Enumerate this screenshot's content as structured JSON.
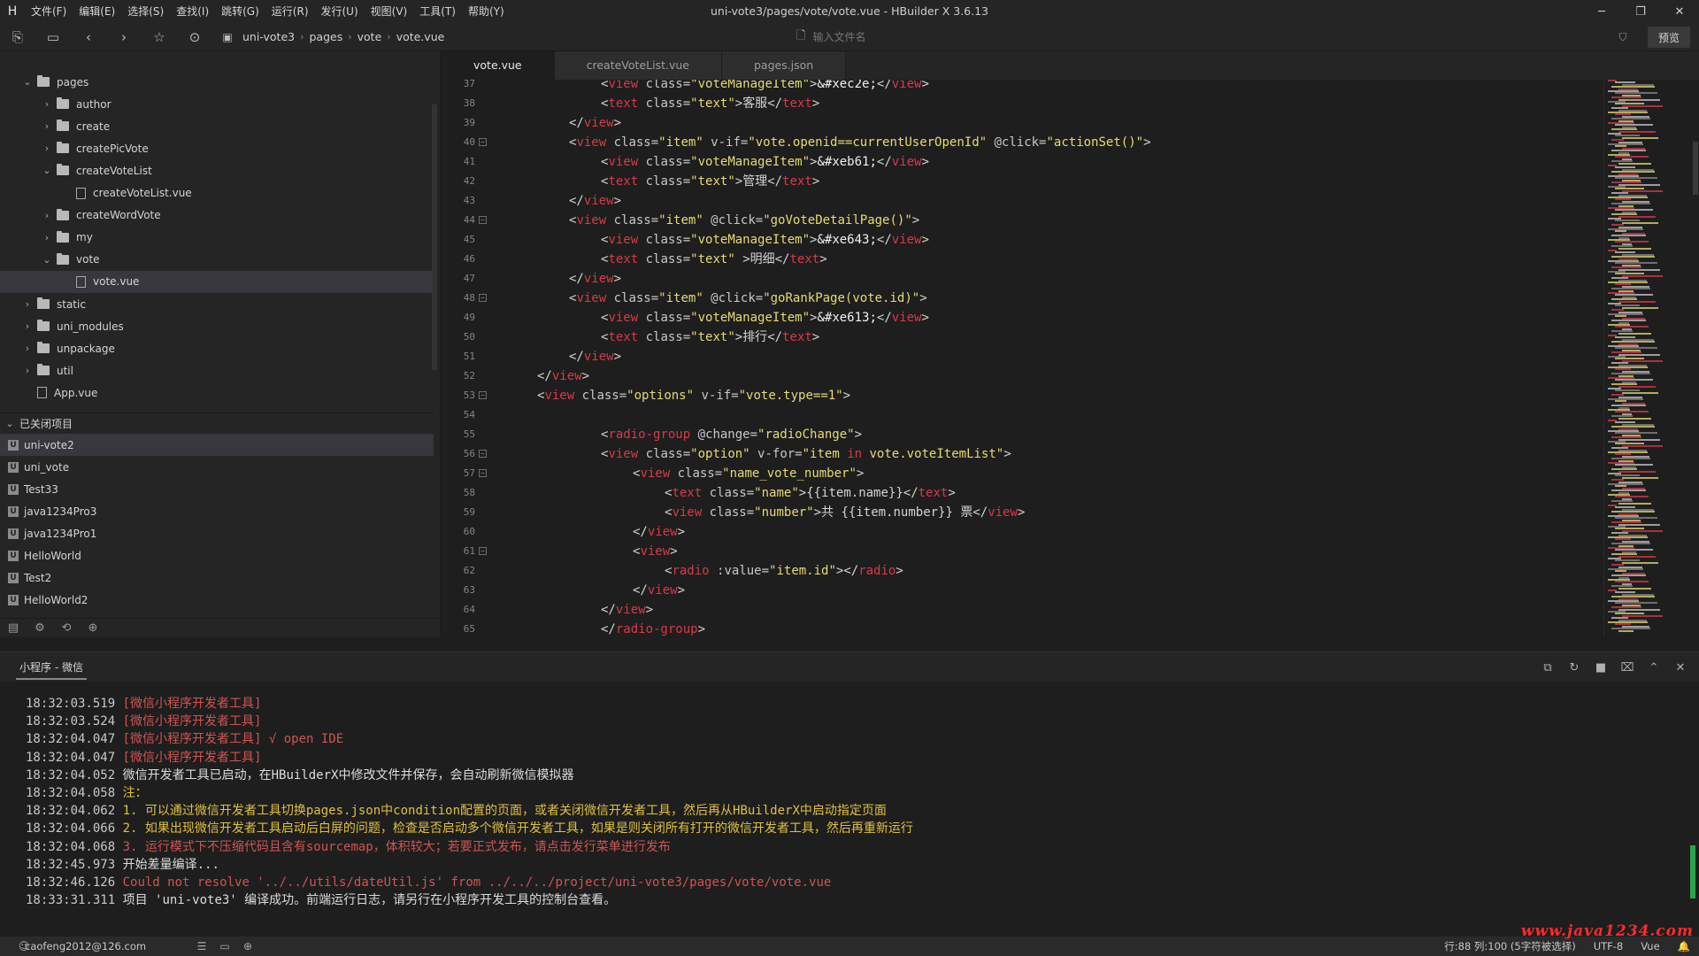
{
  "app": {
    "window_title": "uni-vote3/pages/vote/vote.vue - HBuilder X 3.6.13",
    "menu": [
      "文件(F)",
      "编辑(E)",
      "选择(S)",
      "查找(I)",
      "跳转(G)",
      "运行(R)",
      "发行(U)",
      "视图(V)",
      "工具(T)",
      "帮助(Y)"
    ]
  },
  "toolbar": {
    "breadcrumb": [
      "uni-vote3",
      "pages",
      "vote",
      "vote.vue"
    ],
    "file_search_placeholder": "输入文件名",
    "preview_label": "预览"
  },
  "sidebar": {
    "tree": [
      {
        "label": "pages",
        "type": "folder",
        "depth": 1,
        "expanded": true
      },
      {
        "label": "author",
        "type": "folder",
        "depth": 2,
        "expanded": false
      },
      {
        "label": "create",
        "type": "folder",
        "depth": 2,
        "expanded": false
      },
      {
        "label": "createPicVote",
        "type": "folder",
        "depth": 2,
        "expanded": false
      },
      {
        "label": "createVoteList",
        "type": "folder",
        "depth": 2,
        "expanded": true
      },
      {
        "label": "createVoteList.vue",
        "type": "file",
        "depth": 3
      },
      {
        "label": "createWordVote",
        "type": "folder",
        "depth": 2,
        "expanded": false
      },
      {
        "label": "my",
        "type": "folder",
        "depth": 2,
        "expanded": false
      },
      {
        "label": "vote",
        "type": "folder",
        "depth": 2,
        "expanded": true
      },
      {
        "label": "vote.vue",
        "type": "file",
        "depth": 3,
        "selected": true
      },
      {
        "label": "static",
        "type": "folder",
        "depth": 1,
        "expanded": false
      },
      {
        "label": "uni_modules",
        "type": "folder",
        "depth": 1,
        "expanded": false
      },
      {
        "label": "unpackage",
        "type": "folder",
        "depth": 1,
        "expanded": false
      },
      {
        "label": "util",
        "type": "folder",
        "depth": 1,
        "expanded": false
      },
      {
        "label": "App.vue",
        "type": "file",
        "depth": 1
      }
    ],
    "closed_projects_label": "已关闭项目",
    "closed_projects": [
      "uni-vote2",
      "uni_vote",
      "Test33",
      "java1234Pro3",
      "java1234Pro1",
      "HelloWorld",
      "Test2",
      "HelloWorld2"
    ]
  },
  "editor": {
    "tabs": [
      {
        "label": "vote.vue",
        "active": true
      },
      {
        "label": "createVoteList.vue",
        "active": false
      },
      {
        "label": "pages.json",
        "active": false
      }
    ],
    "lines": [
      {
        "n": "37",
        "fold": false,
        "indent": 3,
        "tokens": [
          [
            "t",
            "<"
          ],
          [
            "g",
            "view"
          ],
          [
            "a",
            " class="
          ],
          [
            "s",
            "\"voteManageItem\""
          ],
          [
            "t",
            ">"
          ],
          [
            "e",
            "&#xec2e;"
          ],
          [
            "t",
            "</"
          ],
          [
            "g",
            "view"
          ],
          [
            "t",
            ">"
          ]
        ]
      },
      {
        "n": "38",
        "fold": false,
        "indent": 3,
        "tokens": [
          [
            "t",
            "<"
          ],
          [
            "g",
            "text"
          ],
          [
            "a",
            " class="
          ],
          [
            "s",
            "\"text\""
          ],
          [
            "t",
            ">"
          ],
          [
            "x",
            "客服"
          ],
          [
            "t",
            "</"
          ],
          [
            "g",
            "text"
          ],
          [
            "t",
            ">"
          ]
        ]
      },
      {
        "n": "39",
        "fold": false,
        "indent": 2,
        "tokens": [
          [
            "t",
            "</"
          ],
          [
            "g",
            "view"
          ],
          [
            "t",
            ">"
          ]
        ]
      },
      {
        "n": "40",
        "fold": true,
        "indent": 2,
        "tokens": [
          [
            "t",
            "<"
          ],
          [
            "g",
            "view"
          ],
          [
            "a",
            " class="
          ],
          [
            "s",
            "\"item\""
          ],
          [
            "a",
            " v-if="
          ],
          [
            "s",
            "\"vote.openid==currentUserOpenId\""
          ],
          [
            "a",
            " @click="
          ],
          [
            "s",
            "\"actionSet()\""
          ],
          [
            "t",
            ">"
          ]
        ]
      },
      {
        "n": "41",
        "fold": false,
        "indent": 3,
        "tokens": [
          [
            "t",
            "<"
          ],
          [
            "g",
            "view"
          ],
          [
            "a",
            " class="
          ],
          [
            "s",
            "\"voteManageItem\""
          ],
          [
            "t",
            ">"
          ],
          [
            "e",
            "&#xeb61;"
          ],
          [
            "t",
            "</"
          ],
          [
            "g",
            "view"
          ],
          [
            "t",
            ">"
          ]
        ]
      },
      {
        "n": "42",
        "fold": false,
        "indent": 3,
        "tokens": [
          [
            "t",
            "<"
          ],
          [
            "g",
            "text"
          ],
          [
            "a",
            " class="
          ],
          [
            "s",
            "\"text\""
          ],
          [
            "t",
            ">"
          ],
          [
            "x",
            "管理"
          ],
          [
            "t",
            "</"
          ],
          [
            "g",
            "text"
          ],
          [
            "t",
            ">"
          ]
        ]
      },
      {
        "n": "43",
        "fold": false,
        "indent": 2,
        "tokens": [
          [
            "t",
            "</"
          ],
          [
            "g",
            "view"
          ],
          [
            "t",
            ">"
          ]
        ]
      },
      {
        "n": "44",
        "fold": true,
        "indent": 2,
        "tokens": [
          [
            "t",
            "<"
          ],
          [
            "g",
            "view"
          ],
          [
            "a",
            " class="
          ],
          [
            "s",
            "\"item\""
          ],
          [
            "a",
            " @click="
          ],
          [
            "s",
            "\"goVoteDetailPage()\""
          ],
          [
            "t",
            ">"
          ]
        ]
      },
      {
        "n": "45",
        "fold": false,
        "indent": 3,
        "tokens": [
          [
            "t",
            "<"
          ],
          [
            "g",
            "view"
          ],
          [
            "a",
            " class="
          ],
          [
            "s",
            "\"voteManageItem\""
          ],
          [
            "t",
            ">"
          ],
          [
            "e",
            "&#xe643;"
          ],
          [
            "t",
            "</"
          ],
          [
            "g",
            "view"
          ],
          [
            "t",
            ">"
          ]
        ]
      },
      {
        "n": "46",
        "fold": false,
        "indent": 3,
        "tokens": [
          [
            "t",
            "<"
          ],
          [
            "g",
            "text"
          ],
          [
            "a",
            " class="
          ],
          [
            "s",
            "\"text\" "
          ],
          [
            "t",
            ">"
          ],
          [
            "x",
            "明细"
          ],
          [
            "t",
            "</"
          ],
          [
            "g",
            "text"
          ],
          [
            "t",
            ">"
          ]
        ]
      },
      {
        "n": "47",
        "fold": false,
        "indent": 2,
        "tokens": [
          [
            "t",
            "</"
          ],
          [
            "g",
            "view"
          ],
          [
            "t",
            ">"
          ]
        ]
      },
      {
        "n": "48",
        "fold": true,
        "indent": 2,
        "tokens": [
          [
            "t",
            "<"
          ],
          [
            "g",
            "view"
          ],
          [
            "a",
            " class="
          ],
          [
            "s",
            "\"item\""
          ],
          [
            "a",
            " @click="
          ],
          [
            "s",
            "\"goRankPage(vote.id)\""
          ],
          [
            "t",
            ">"
          ]
        ]
      },
      {
        "n": "49",
        "fold": false,
        "indent": 3,
        "tokens": [
          [
            "t",
            "<"
          ],
          [
            "g",
            "view"
          ],
          [
            "a",
            " class="
          ],
          [
            "s",
            "\"voteManageItem\""
          ],
          [
            "t",
            ">"
          ],
          [
            "e",
            "&#xe613;"
          ],
          [
            "t",
            "</"
          ],
          [
            "g",
            "view"
          ],
          [
            "t",
            ">"
          ]
        ]
      },
      {
        "n": "50",
        "fold": false,
        "indent": 3,
        "tokens": [
          [
            "t",
            "<"
          ],
          [
            "g",
            "text"
          ],
          [
            "a",
            " class="
          ],
          [
            "s",
            "\"text\""
          ],
          [
            "t",
            ">"
          ],
          [
            "x",
            "排行"
          ],
          [
            "t",
            "</"
          ],
          [
            "g",
            "text"
          ],
          [
            "t",
            ">"
          ]
        ]
      },
      {
        "n": "51",
        "fold": false,
        "indent": 2,
        "tokens": [
          [
            "t",
            "</"
          ],
          [
            "g",
            "view"
          ],
          [
            "t",
            ">"
          ]
        ]
      },
      {
        "n": "52",
        "fold": false,
        "indent": 1,
        "tokens": [
          [
            "t",
            "</"
          ],
          [
            "g",
            "view"
          ],
          [
            "t",
            ">"
          ]
        ]
      },
      {
        "n": "53",
        "fold": true,
        "indent": 1,
        "tokens": [
          [
            "t",
            "<"
          ],
          [
            "g",
            "view"
          ],
          [
            "a",
            " class="
          ],
          [
            "s",
            "\"options\""
          ],
          [
            "a",
            " v-if="
          ],
          [
            "s",
            "\"vote.type==1\""
          ],
          [
            "t",
            ">"
          ]
        ]
      },
      {
        "n": "54",
        "fold": false,
        "indent": 0,
        "tokens": []
      },
      {
        "n": "55",
        "fold": false,
        "indent": 3,
        "tokens": [
          [
            "t",
            "<"
          ],
          [
            "g",
            "radio-group"
          ],
          [
            "a",
            " @change="
          ],
          [
            "s",
            "\"radioChange\""
          ],
          [
            "t",
            ">"
          ]
        ]
      },
      {
        "n": "56",
        "fold": true,
        "indent": 3,
        "tokens": [
          [
            "t",
            "<"
          ],
          [
            "g",
            "view"
          ],
          [
            "a",
            " class="
          ],
          [
            "s",
            "\"option\""
          ],
          [
            "a",
            " v-for="
          ],
          [
            "s",
            "\"item "
          ],
          [
            "k",
            "in"
          ],
          [
            "s",
            " vote.voteItemList\""
          ],
          [
            "t",
            ">"
          ]
        ]
      },
      {
        "n": "57",
        "fold": true,
        "indent": 4,
        "tokens": [
          [
            "t",
            "<"
          ],
          [
            "g",
            "view"
          ],
          [
            "a",
            " class="
          ],
          [
            "s",
            "\"name_vote_number\""
          ],
          [
            "t",
            ">"
          ]
        ]
      },
      {
        "n": "58",
        "fold": false,
        "indent": 5,
        "tokens": [
          [
            "t",
            "<"
          ],
          [
            "g",
            "text"
          ],
          [
            "a",
            " class="
          ],
          [
            "s",
            "\"name\""
          ],
          [
            "t",
            ">"
          ],
          [
            "x",
            "{{item.name}}"
          ],
          [
            "t",
            "</"
          ],
          [
            "g",
            "text"
          ],
          [
            "t",
            ">"
          ]
        ]
      },
      {
        "n": "59",
        "fold": false,
        "indent": 5,
        "tokens": [
          [
            "t",
            "<"
          ],
          [
            "g",
            "view"
          ],
          [
            "a",
            " class="
          ],
          [
            "s",
            "\"number\""
          ],
          [
            "t",
            ">"
          ],
          [
            "x",
            "共 {{item.number}} 票"
          ],
          [
            "t",
            "</"
          ],
          [
            "g",
            "view"
          ],
          [
            "t",
            ">"
          ]
        ]
      },
      {
        "n": "60",
        "fold": false,
        "indent": 4,
        "tokens": [
          [
            "t",
            "</"
          ],
          [
            "g",
            "view"
          ],
          [
            "t",
            ">"
          ]
        ]
      },
      {
        "n": "61",
        "fold": true,
        "indent": 4,
        "tokens": [
          [
            "t",
            "<"
          ],
          [
            "g",
            "view"
          ],
          [
            "t",
            ">"
          ]
        ]
      },
      {
        "n": "62",
        "fold": false,
        "indent": 5,
        "tokens": [
          [
            "t",
            "<"
          ],
          [
            "g",
            "radio"
          ],
          [
            "a",
            " :value="
          ],
          [
            "s",
            "\"item.id\""
          ],
          [
            "t",
            "></"
          ],
          [
            "g",
            "radio"
          ],
          [
            "t",
            ">"
          ]
        ]
      },
      {
        "n": "63",
        "fold": false,
        "indent": 4,
        "tokens": [
          [
            "t",
            "</"
          ],
          [
            "g",
            "view"
          ],
          [
            "t",
            ">"
          ]
        ]
      },
      {
        "n": "64",
        "fold": false,
        "indent": 3,
        "tokens": [
          [
            "t",
            "</"
          ],
          [
            "g",
            "view"
          ],
          [
            "t",
            ">"
          ]
        ]
      },
      {
        "n": "65",
        "fold": false,
        "indent": 3,
        "tokens": [
          [
            "t",
            "</"
          ],
          [
            "g",
            "radio-group"
          ],
          [
            "t",
            ">"
          ]
        ]
      }
    ]
  },
  "console": {
    "title": "小程序 - 微信",
    "lines": [
      {
        "time": "18:32:03.519",
        "parts": [
          [
            "tag",
            "[微信小程序开发者工具]"
          ]
        ]
      },
      {
        "time": "18:32:03.524",
        "parts": [
          [
            "tag",
            "[微信小程序开发者工具]"
          ]
        ]
      },
      {
        "time": "18:32:04.047",
        "parts": [
          [
            "tag",
            "[微信小程序开发者工具] √ open IDE"
          ]
        ]
      },
      {
        "time": "18:32:04.047",
        "parts": [
          [
            "tag",
            "[微信小程序开发者工具]"
          ]
        ]
      },
      {
        "time": "18:32:04.052",
        "parts": [
          [
            "white",
            "微信开发者工具已启动，在HBuilderX中修改文件并保存，会自动刷新微信模拟器"
          ]
        ]
      },
      {
        "time": "18:32:04.058",
        "parts": [
          [
            "yellow",
            "注："
          ]
        ]
      },
      {
        "time": "18:32:04.062",
        "parts": [
          [
            "yellow",
            "1. 可以通过微信开发者工具切换pages.json中condition配置的页面，或者关闭微信开发者工具，然后再从HBuilderX中启动指定页面"
          ]
        ]
      },
      {
        "time": "18:32:04.066",
        "parts": [
          [
            "yellow",
            "2. 如果出现微信开发者工具启动后白屏的问题，检查是否启动多个微信开发者工具，如果是则关闭所有打开的微信开发者工具，然后再重新运行"
          ]
        ]
      },
      {
        "time": "18:32:04.068",
        "parts": [
          [
            "err",
            "3. 运行模式下不压缩代码且含有sourcemap，体积较大；若要正式发布，请点击发行菜单进行发布"
          ]
        ]
      },
      {
        "time": "18:32:45.973",
        "parts": [
          [
            "white",
            "开始差量编译..."
          ]
        ]
      },
      {
        "time": "18:32:46.126",
        "parts": [
          [
            "err",
            "Could not resolve '../../utils/dateUtil.js' from ../../../project/uni-vote3/pages/vote/vote.vue"
          ]
        ]
      },
      {
        "time": "18:33:31.311",
        "parts": [
          [
            "white",
            "项目 'uni-vote3' 编译成功。前端运行日志，请另行在小程序开发工具的控制台查看。"
          ]
        ]
      }
    ]
  },
  "statusbar": {
    "user": "caofeng2012@126.com",
    "position": "行:88  列:100 (5字符被选择)",
    "encoding": "UTF-8",
    "language": "Vue",
    "watermark": "www.java1234.com"
  },
  "colors": {
    "tag": "#d73a49",
    "string": "#e6db74",
    "log_error": "#d05454",
    "log_warn": "#e0c040"
  }
}
